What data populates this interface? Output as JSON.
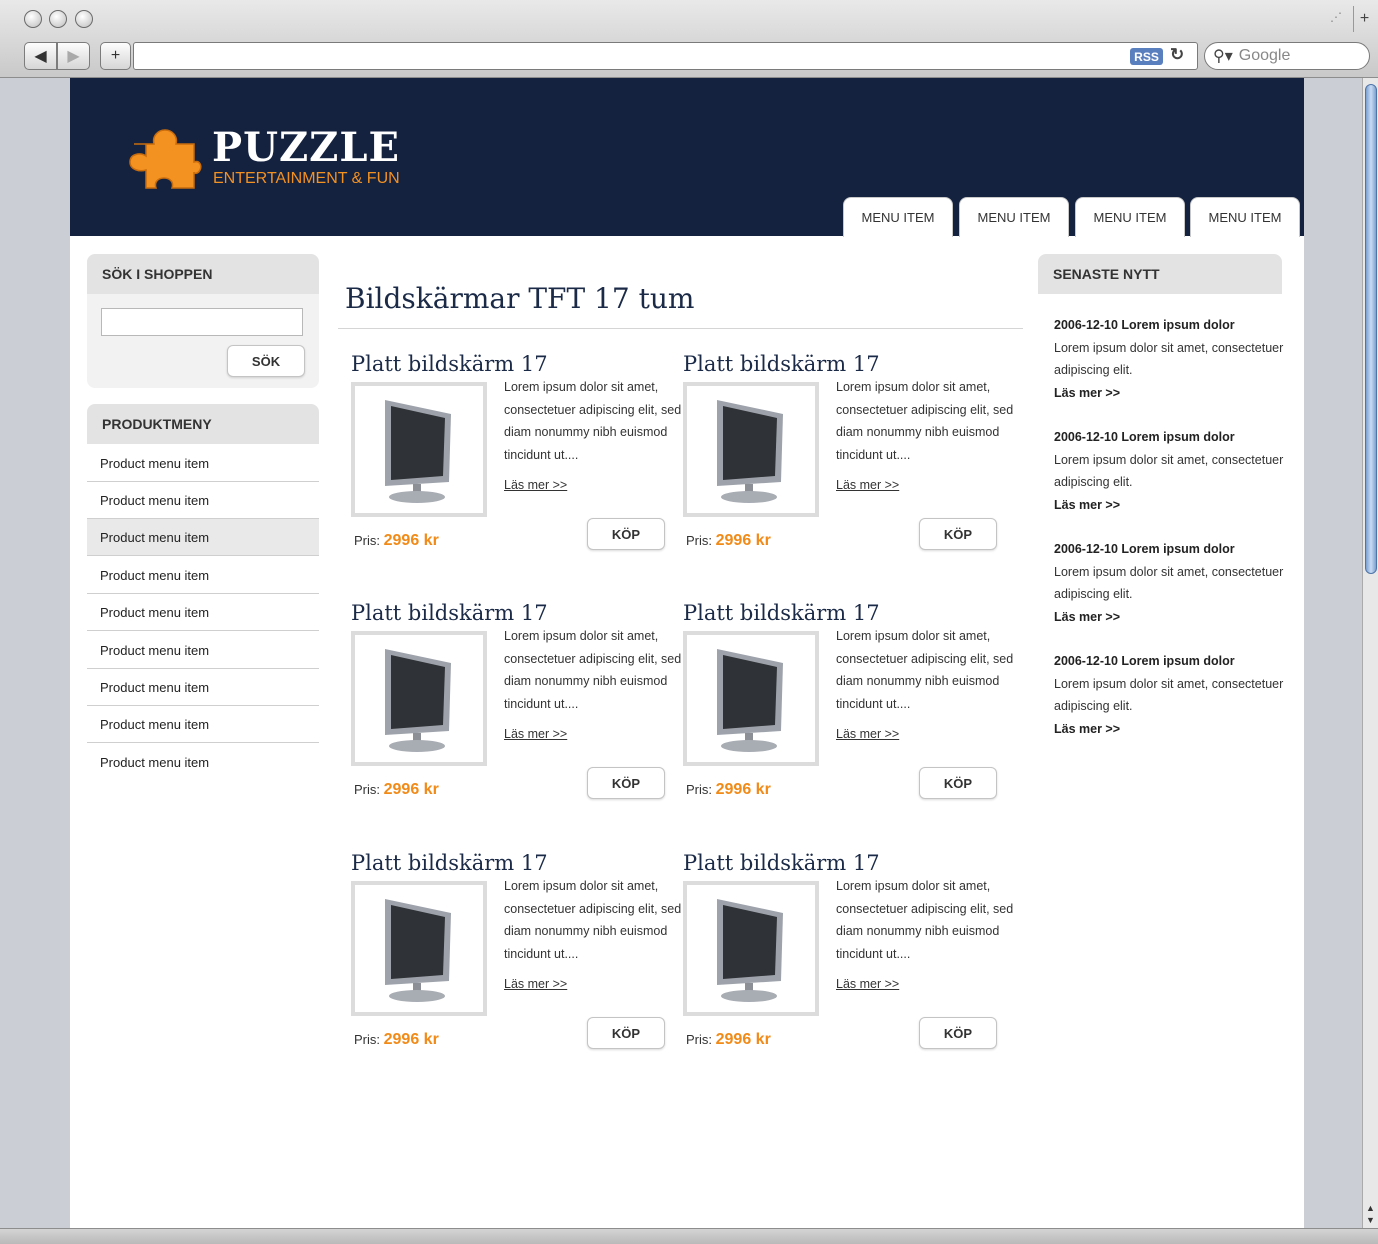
{
  "browser": {
    "address_url": "",
    "search_placeholder": "Google",
    "rss_label": "RSS"
  },
  "site": {
    "logo_title": "PUZZLE",
    "logo_subtitle": "ENTERTAINMENT & FUN",
    "nav": [
      "MENU ITEM",
      "MENU ITEM",
      "MENU ITEM",
      "MENU ITEM"
    ],
    "accent_color": "#f18a17",
    "header_color": "#142240"
  },
  "sidebar": {
    "search_title": "SÖK I SHOPPEN",
    "search_button": "SÖK",
    "menu_title": "PRODUKTMENY",
    "menu_items": [
      "Product menu item",
      "Product menu item",
      "Product menu item",
      "Product menu item",
      "Product menu item",
      "Product menu item",
      "Product menu item",
      "Product menu item",
      "Product menu item"
    ]
  },
  "main": {
    "title": "Bildskärmar TFT 17 tum",
    "products": [
      {
        "title": "Platt bildskärm 17",
        "desc": "Lorem ipsum dolor sit amet, consectetuer adipiscing elit, sed diam nonummy nibh euismod tincidunt ut....",
        "more": "Läs mer >>",
        "price_label": "Pris:",
        "price": "2996 kr",
        "buy": "KÖP"
      },
      {
        "title": "Platt bildskärm 17",
        "desc": "Lorem ipsum dolor sit amet, consectetuer adipiscing elit, sed diam nonummy nibh euismod tincidunt ut....",
        "more": "Läs mer >>",
        "price_label": "Pris:",
        "price": "2996 kr",
        "buy": "KÖP"
      },
      {
        "title": "Platt bildskärm 17",
        "desc": "Lorem ipsum dolor sit amet, consectetuer adipiscing elit, sed diam nonummy nibh euismod tincidunt ut....",
        "more": "Läs mer >>",
        "price_label": "Pris:",
        "price": "2996 kr",
        "buy": "KÖP"
      },
      {
        "title": "Platt bildskärm 17",
        "desc": "Lorem ipsum dolor sit amet, consectetuer adipiscing elit, sed diam nonummy nibh euismod tincidunt ut....",
        "more": "Läs mer >>",
        "price_label": "Pris:",
        "price": "2996 kr",
        "buy": "KÖP"
      },
      {
        "title": "Platt bildskärm 17",
        "desc": "Lorem ipsum dolor sit amet, consectetuer adipiscing elit, sed diam nonummy nibh euismod tincidunt ut....",
        "more": "Läs mer >>",
        "price_label": "Pris:",
        "price": "2996 kr",
        "buy": "KÖP"
      },
      {
        "title": "Platt bildskärm 17",
        "desc": "Lorem ipsum dolor sit amet, consectetuer adipiscing elit, sed diam nonummy nibh euismod tincidunt ut....",
        "more": "Läs mer >>",
        "price_label": "Pris:",
        "price": "2996 kr",
        "buy": "KÖP"
      }
    ]
  },
  "news": {
    "title": "SENASTE NYTT",
    "items": [
      {
        "heading": "2006-12-10 Lorem ipsum dolor",
        "body": "Lorem ipsum dolor sit amet, consectetuer adipiscing elit.",
        "more": "Läs mer >>"
      },
      {
        "heading": "2006-12-10 Lorem ipsum dolor",
        "body": "Lorem ipsum dolor sit amet, consectetuer adipiscing elit.",
        "more": "Läs mer >>"
      },
      {
        "heading": "2006-12-10 Lorem ipsum dolor",
        "body": "Lorem ipsum dolor sit amet, consectetuer adipiscing elit.",
        "more": "Läs mer >>"
      },
      {
        "heading": "2006-12-10 Lorem ipsum dolor",
        "body": "Lorem ipsum dolor sit amet, consectetuer adipiscing elit.",
        "more": "Läs mer >>"
      }
    ]
  }
}
